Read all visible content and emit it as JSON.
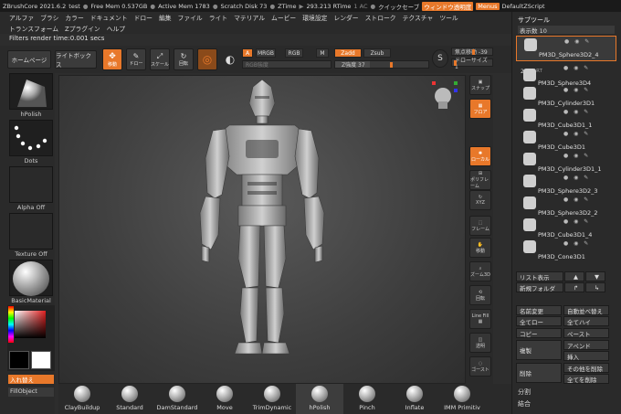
{
  "titlebar": {
    "app": "ZBrushCore 2021.6.2",
    "doc": "test",
    "free_mem": "Free Mem 0.537GB",
    "active_mem": "Active Mem 1783",
    "scratch": "Scratch Disk 73",
    "ztime": "ZTime",
    "rtime": "293.213 RTime",
    "rtime_val": "1 AC",
    "quicksave": "クイックセーブ",
    "window_trans": "ウィンドウ透明度",
    "menus": "Menus",
    "script": "DefaultZScript"
  },
  "menubar": {
    "row1": [
      "アルファ",
      "ブラシ",
      "カラー",
      "ドキュメント",
      "ドロー",
      "編集",
      "ファイル",
      "ライト",
      "マテリアル",
      "ムービー",
      "環境設定",
      "レンダー",
      "ストローク",
      "テクスチャ",
      "ツール"
    ],
    "row2": [
      "トランスフォーム",
      "Zプラグイン",
      "ヘルプ"
    ]
  },
  "filters_text": "Filters render time:0.001 secs",
  "toolbar": {
    "home": "ホームページ",
    "lightbox": "ライトボックス",
    "move_label": "移動",
    "scale_label": "スケール",
    "rotate_label": "回転",
    "edit_label": "編集",
    "draw_label": "ドロー",
    "a": "A",
    "mrgb": "MRGB",
    "rgb": "RGB",
    "m": "M",
    "zadd": "Zadd",
    "zsub": "Zsub",
    "rgb_intensity": "RGB強度",
    "z_intensity": "Z強度 37",
    "focal": "焦点移動 -39",
    "draw_size": "ドローサイズ 1"
  },
  "left": {
    "brush_label": "hPolish",
    "stroke_label": "Dots",
    "alpha_label": "Alpha Off",
    "texture_label": "Texture Off",
    "material_label": "BasicMaterial",
    "swap_label": "入れ替え",
    "fillobject": "FillObject"
  },
  "rtools": [
    "スナップ",
    "フロア",
    "ローカル",
    "ポリフレーム",
    "XYZ",
    "フレーム",
    "移動",
    "ズーム3D",
    "回転",
    "Line Fill",
    "ポリF",
    "透明",
    "ゴースト"
  ],
  "rpanel": {
    "title": "サブツール",
    "visible": "表示数 10",
    "start_label": "START",
    "num_21": "21",
    "subtools": [
      "PM3D_Sphere3D2_4",
      "PM3D_Sphere3D4",
      "PM3D_Cylinder3D1",
      "PM3D_Cube3D1_1",
      "PM3D_Cube3D1",
      "PM3D_Cylinder3D1_1",
      "PM3D_Sphere3D2_3",
      "PM3D_Sphere3D2_2",
      "PM3D_Cube3D1_4",
      "PM3D_Cone3D1"
    ],
    "list_show": "リスト表示",
    "new_folder": "新規フォルダ",
    "rename": "名前変更",
    "auto_reorder": "自動並べ替え",
    "all_low": "全てロー",
    "all_high": "全てハイ",
    "copy": "コピー",
    "paste": "ペースト",
    "dup": "複製",
    "append": "アペンド",
    "insert": "挿入",
    "delete": "削除",
    "del_others": "その他を削除",
    "del_all": "全てを削除",
    "split": "分割",
    "merge": "結合"
  },
  "brushes": [
    "ClayBuildup",
    "Standard",
    "DamStandard",
    "Move",
    "TrimDynamic",
    "hPolish",
    "Pinch",
    "Inflate",
    "IMM Primitiv"
  ],
  "colors": {
    "accent": "#e8782a",
    "bg": "#2d2d2d"
  }
}
